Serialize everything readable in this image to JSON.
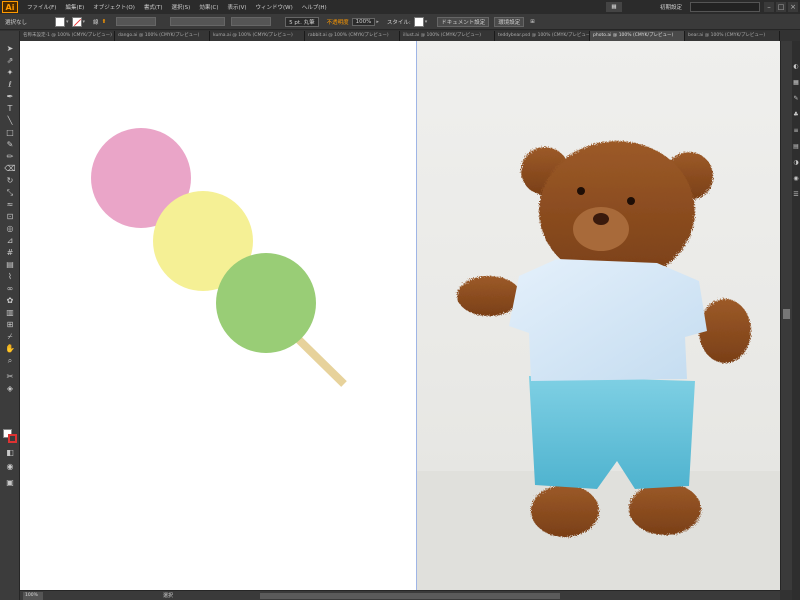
{
  "app": {
    "logo": "Ai"
  },
  "menu": {
    "items": [
      "ファイル(F)",
      "編集(E)",
      "オブジェクト(O)",
      "書式(T)",
      "選択(S)",
      "効果(C)",
      "表示(V)",
      "ウィンドウ(W)",
      "ヘルプ(H)"
    ],
    "workspace_label": "初期設定",
    "search_placeholder": ""
  },
  "control_bar": {
    "selection_label": "選択なし",
    "stroke_label": "線",
    "brush_label": "5 pt. 丸筆",
    "opacity_label": "不透明度",
    "opacity_value": "100%",
    "style_label": "スタイル:",
    "doc_setup_button": "ドキュメント設定",
    "preferences_button": "環境設定"
  },
  "tabs": [
    {
      "label": "名称未設定-1 @ 100% (CMYK/プレビュー)"
    },
    {
      "label": "dango.ai @ 100% (CMYK/プレビュー)"
    },
    {
      "label": "kuma.ai @ 100% (CMYK/プレビュー)"
    },
    {
      "label": "rabbit.ai @ 100% (CMYK/プレビュー)"
    },
    {
      "label": "illust.ai @ 100% (CMYK/プレビュー)"
    },
    {
      "label": "teddybear.psd @ 100% (CMYK/プレビュー)"
    },
    {
      "label": "photo.ai @ 100% (CMYK/プレビュー)"
    },
    {
      "label": "bear.ai @ 100% (CMYK/プレビュー)"
    }
  ],
  "status_bar": {
    "zoom": "100%",
    "tool": "選択"
  },
  "colors": {
    "dango_pink": "#eaa5c8",
    "dango_yellow": "#f5f095",
    "dango_green": "#99cd76",
    "stick": "#e7d29b",
    "bear_fur": "#8a4a1f",
    "shirt": "#d3e6f6",
    "shorts": "#5fbcd6",
    "accent": "#ff9a00"
  },
  "icons": [
    "selection-tool-icon",
    "direct-selection-tool-icon",
    "magic-wand-icon",
    "lasso-icon",
    "pen-tool-icon",
    "type-tool-icon",
    "line-tool-icon",
    "rectangle-tool-icon",
    "paintbrush-icon",
    "pencil-icon",
    "eraser-icon",
    "rotate-icon",
    "scale-icon",
    "width-icon",
    "free-transform-icon",
    "shape-builder-icon",
    "perspective-icon",
    "mesh-icon",
    "gradient-icon",
    "eyedropper-icon",
    "blend-icon",
    "symbol-sprayer-icon",
    "graph-icon",
    "artboard-icon",
    "slice-icon",
    "hand-icon",
    "zoom-icon"
  ]
}
